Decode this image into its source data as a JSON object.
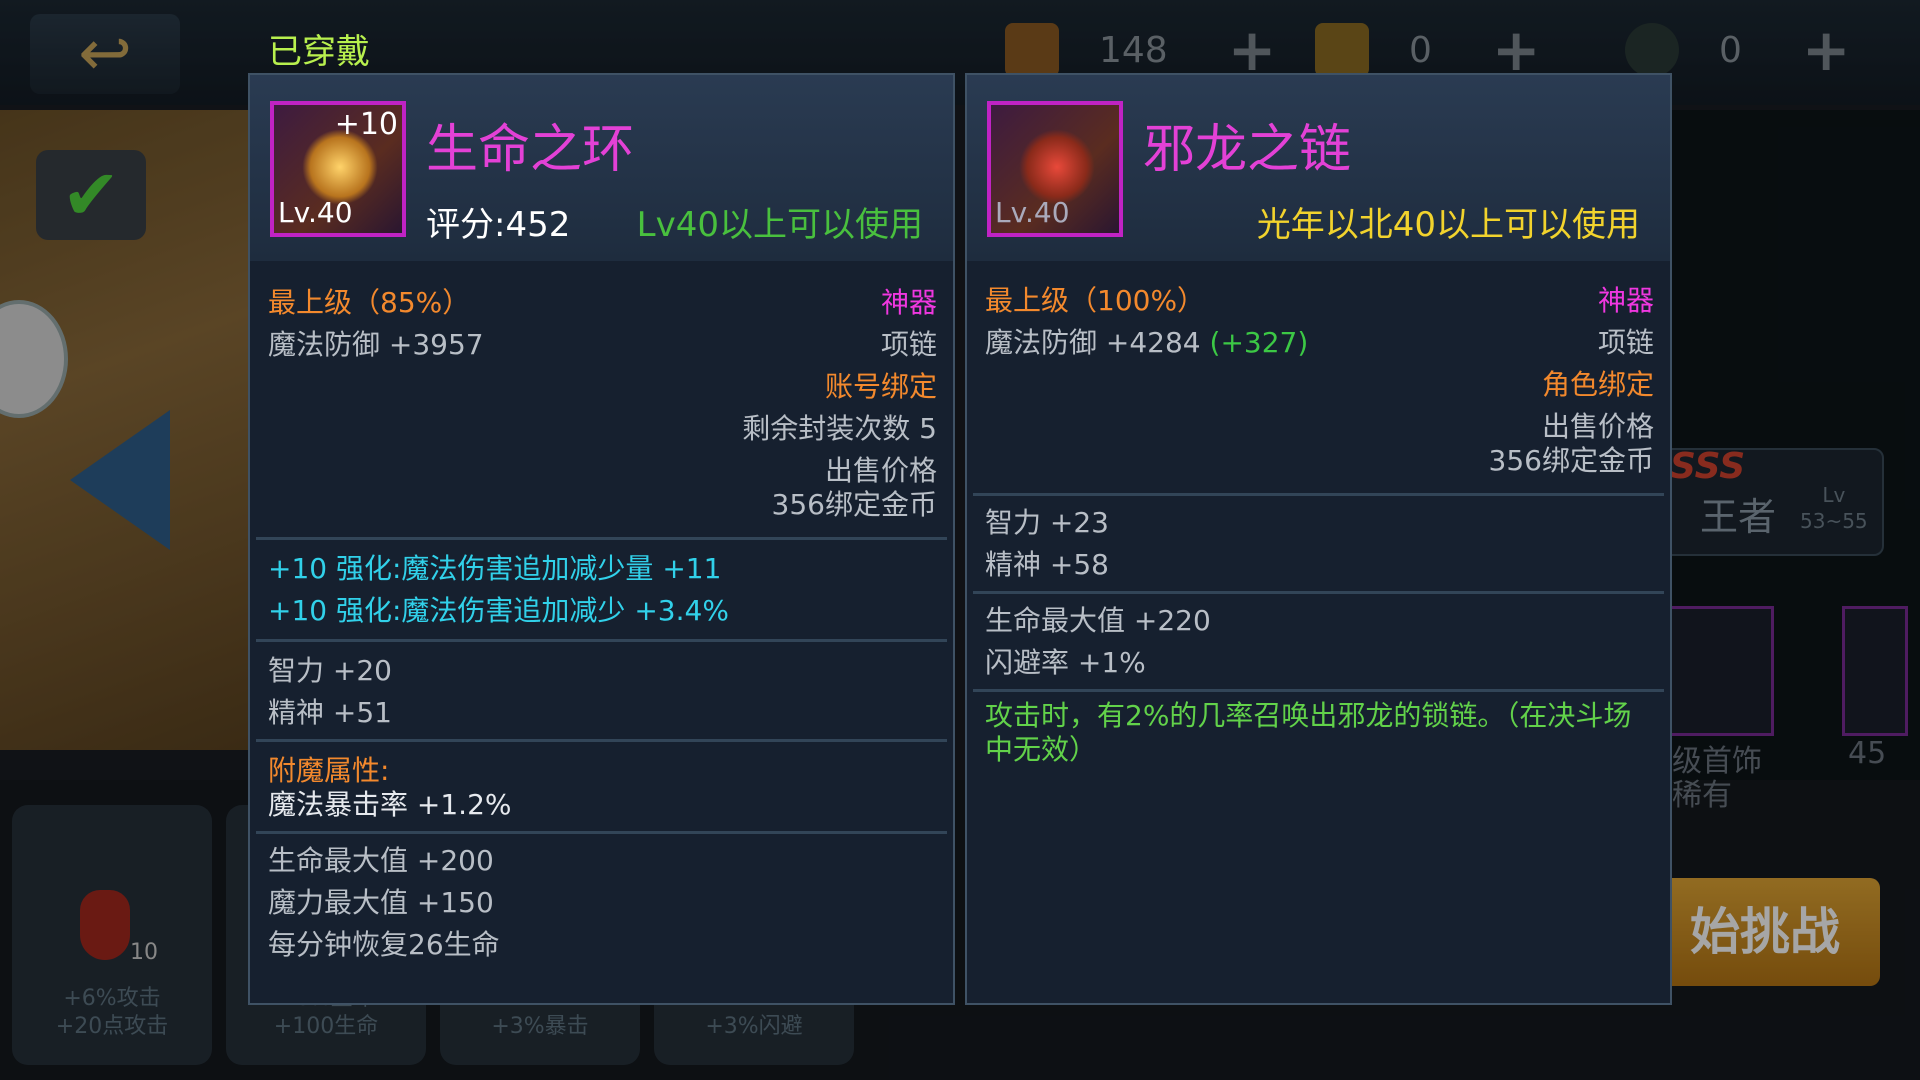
{
  "background": {
    "top_bar": {
      "resources": [
        {
          "icon": "scroll-icon",
          "value": "148",
          "plus": "+"
        },
        {
          "icon": "star-scroll-icon",
          "value": "0",
          "plus": "+"
        },
        {
          "icon": "energy-icon",
          "value": "0",
          "plus": "+"
        }
      ]
    },
    "rank": {
      "sss": "SSS",
      "name": "王者",
      "lv_label": "Lv",
      "lv_range": "53~55"
    },
    "thumb_label_1": "级首饰",
    "thumb_label_2": "稀有",
    "thumb_label_3": "45",
    "start_button": "始挑战",
    "bottom_cards": [
      {
        "line1": "+6%攻击",
        "line2": "+20点攻击"
      },
      {
        "line1": "+6%生命",
        "line2": "+100生命"
      },
      {
        "line1": "+3%暴击",
        "line2": ""
      },
      {
        "line1": "+3%闪避",
        "line2": ""
      }
    ],
    "potion_count": "10"
  },
  "equipped_label": "已穿戴",
  "left_item": {
    "enhance": "+10",
    "icon_level": "Lv.40",
    "name": "生命之环",
    "score": "评分:452",
    "requirement": "Lv40以上可以使用",
    "grade": "最上级（85%）",
    "rarity": "神器",
    "base_stat": "魔法防御 +3957",
    "slot": "项链",
    "binding": "账号绑定",
    "seal_count": "剩余封装次数 5",
    "sell_label": "出售价格",
    "sell_value": "356绑定金币",
    "enhance_lines": [
      "+10 强化:魔法伤害追加减少量 +11",
      "+10 强化:魔法伤害追加减少 +3.4%"
    ],
    "stats": [
      "智力 +20",
      "精神 +51"
    ],
    "enchant_title": "附魔属性:",
    "enchant_value": "魔法暴击率 +1.2%",
    "extra_stats": [
      "生命最大值 +200",
      "魔力最大值 +150",
      "每分钟恢复26生命"
    ]
  },
  "right_item": {
    "icon_level": "Lv.40",
    "name": "邪龙之链",
    "requirement": "光年以北40以上可以使用",
    "grade": "最上级（100%）",
    "rarity": "神器",
    "base_stat": "魔法防御 +4284",
    "base_stat_diff": "(+327)",
    "slot": "项链",
    "binding": "角色绑定",
    "sell_label": "出售价格",
    "sell_value": "356绑定金币",
    "stats": [
      "智力 +23",
      "精神 +58"
    ],
    "stats2": [
      "生命最大值 +220",
      "闪避率 +1%"
    ],
    "effect": "攻击时，有2%的几率召唤出邪龙的锁链。（在决斗场中无效）"
  }
}
